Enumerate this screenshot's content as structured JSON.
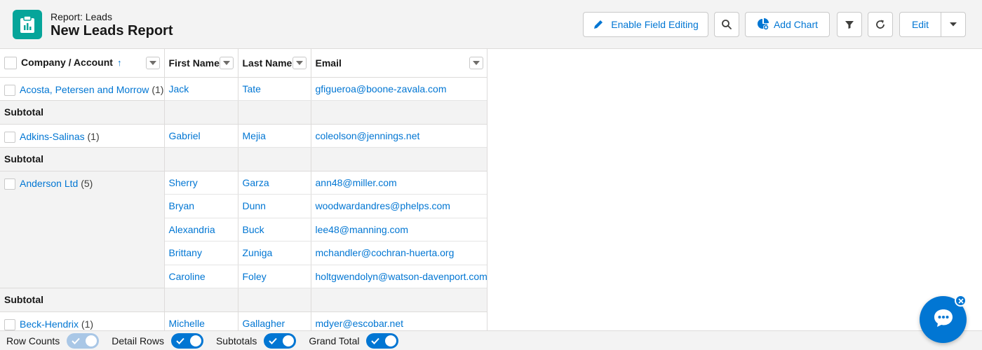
{
  "header": {
    "kicker": "Report: Leads",
    "title": "New Leads Report",
    "enable_field_editing": "Enable Field Editing",
    "add_chart": "Add Chart",
    "edit": "Edit"
  },
  "table": {
    "columns": [
      "Company / Account",
      "First Name",
      "Last Name",
      "Email"
    ],
    "subtotal_label": "Subtotal",
    "groups": [
      {
        "company": "Acosta, Petersen and Morrow",
        "count": "(1)",
        "rows": [
          {
            "first": "Jack",
            "last": "Tate",
            "email": "gfigueroa@boone-zavala.com"
          }
        ]
      },
      {
        "company": "Adkins-Salinas",
        "count": "(1)",
        "rows": [
          {
            "first": "Gabriel",
            "last": "Mejia",
            "email": "coleolson@jennings.net"
          }
        ]
      },
      {
        "company": "Anderson Ltd",
        "count": "(5)",
        "rows": [
          {
            "first": "Sherry",
            "last": "Garza",
            "email": "ann48@miller.com"
          },
          {
            "first": "Bryan",
            "last": "Dunn",
            "email": "woodwardandres@phelps.com"
          },
          {
            "first": "Alexandria",
            "last": "Buck",
            "email": "lee48@manning.com"
          },
          {
            "first": "Brittany",
            "last": "Zuniga",
            "email": "mchandler@cochran-huerta.org"
          },
          {
            "first": "Caroline",
            "last": "Foley",
            "email": "holtgwendolyn@watson-davenport.com"
          }
        ]
      },
      {
        "company": "Beck-Hendrix",
        "count": "(1)",
        "rows": [
          {
            "first": "Michelle",
            "last": "Gallagher",
            "email": "mdyer@escobar.net"
          }
        ]
      }
    ]
  },
  "footer": {
    "row_counts": "Row Counts",
    "detail_rows": "Detail Rows",
    "subtotals": "Subtotals",
    "grand_total": "Grand Total",
    "row_counts_on": false,
    "detail_rows_on": true,
    "subtotals_on": true,
    "grand_total_on": true
  },
  "colors": {
    "brand": "#0176d3",
    "report_icon": "#06a59a",
    "header_bg": "#f3f3f3"
  },
  "icons": [
    "report-icon",
    "pencil-icon",
    "search-icon",
    "add-chart-icon",
    "filter-icon",
    "refresh-icon",
    "chevron-down-icon",
    "sort-up-icon",
    "chat-icon",
    "close-icon",
    "check-icon"
  ]
}
